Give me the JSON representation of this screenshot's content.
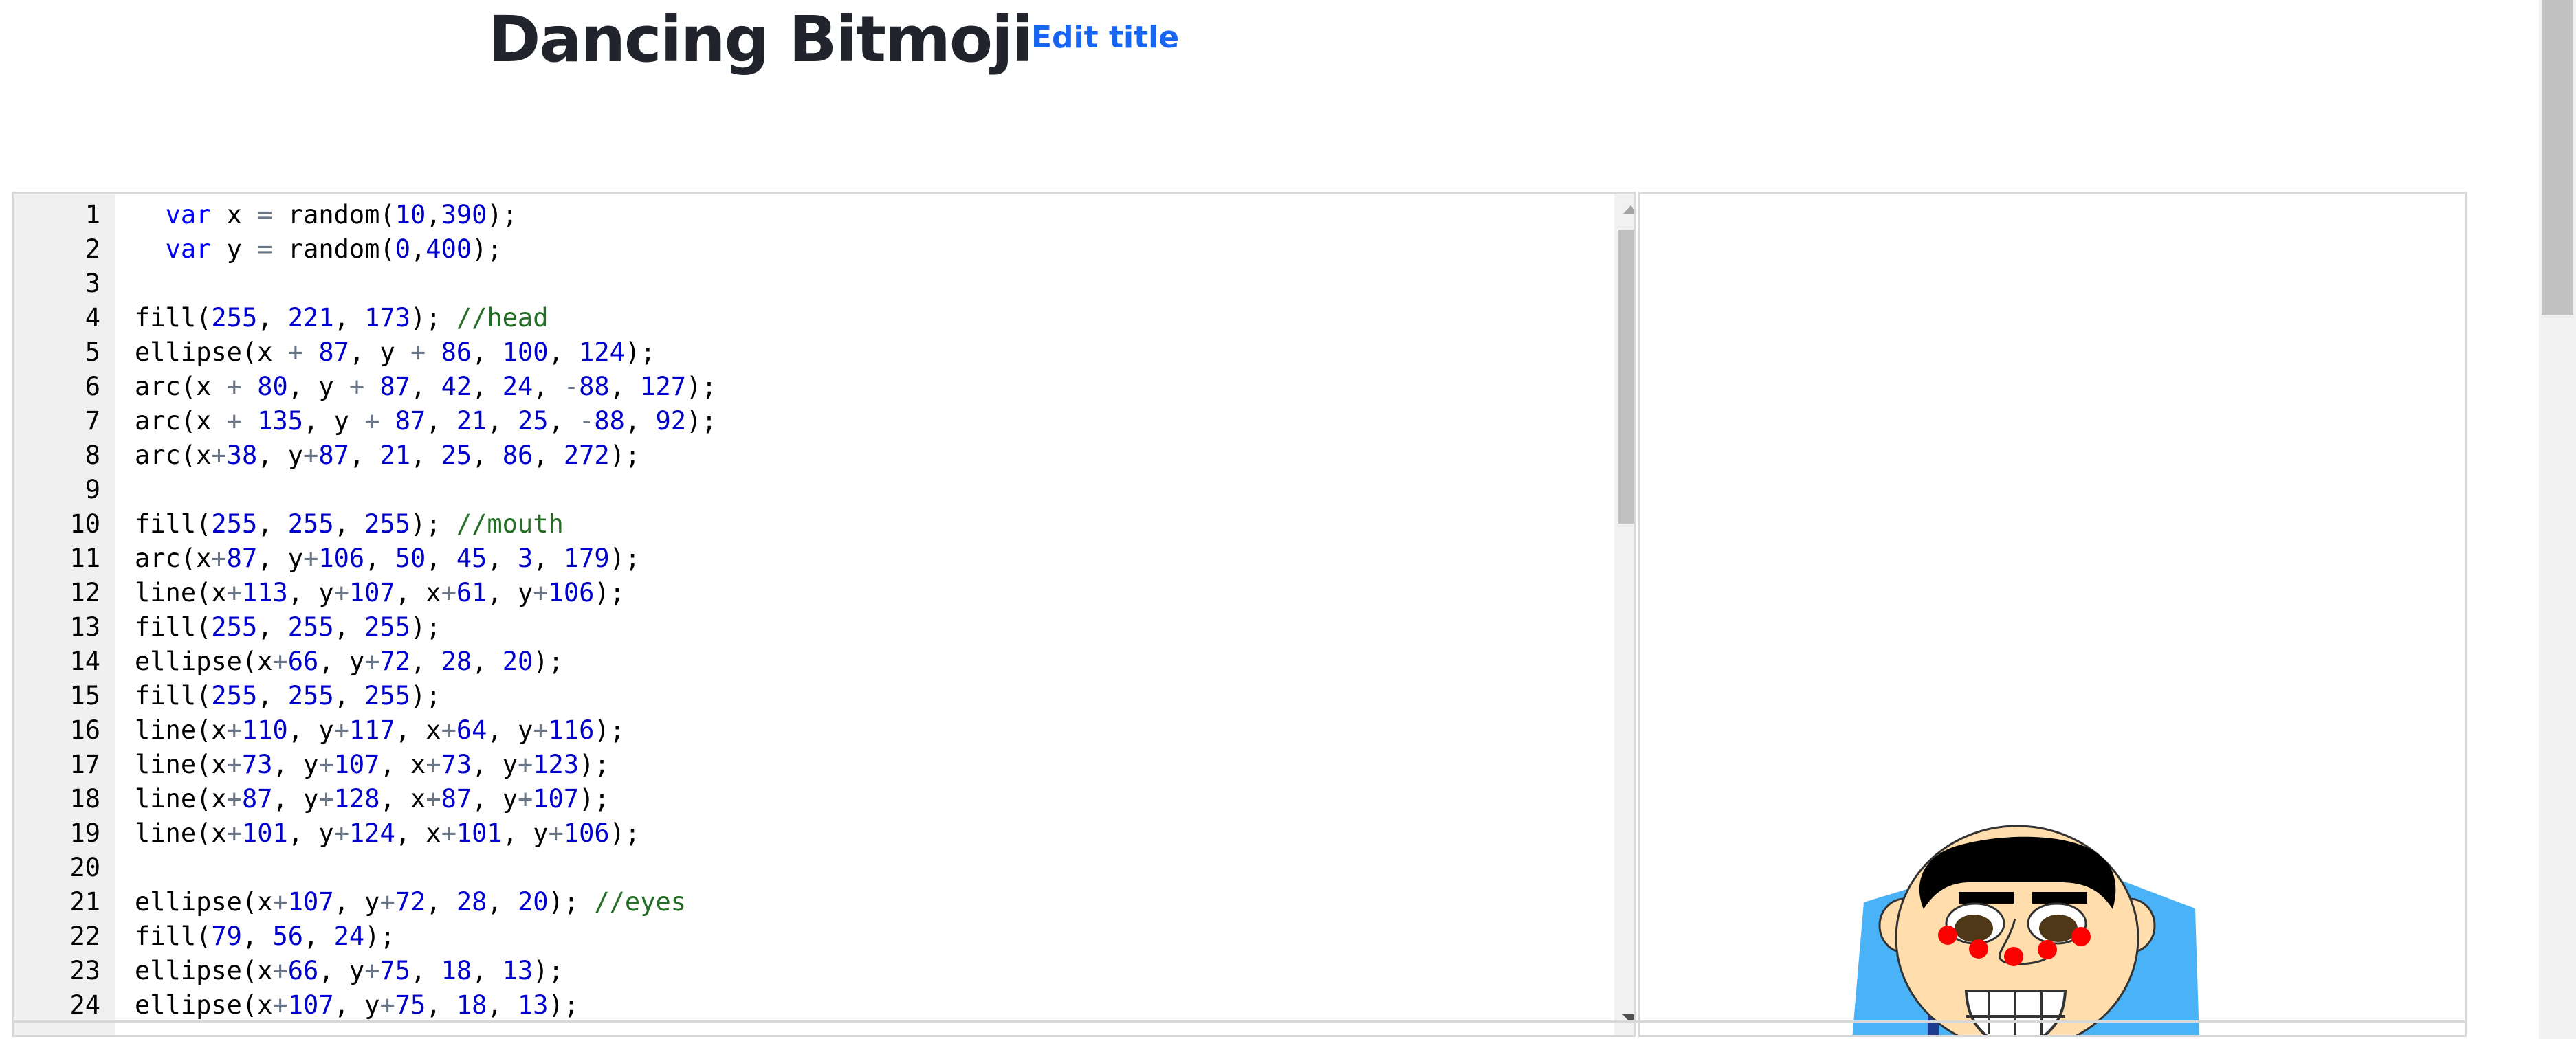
{
  "header": {
    "title": "Dancing Bitmoji",
    "edit_title_label": "Edit title"
  },
  "editor": {
    "line_numbers": [
      "1",
      "2",
      "3",
      "4",
      "5",
      "6",
      "7",
      "8",
      "9",
      "10",
      "11",
      "12",
      "13",
      "14",
      "15",
      "16",
      "17",
      "18",
      "19",
      "20",
      "21",
      "22",
      "23",
      "24"
    ],
    "lines": [
      "  var x = random(10,390);",
      "  var y = random(0,400);",
      "",
      "fill(255, 221, 173); //head",
      "ellipse(x + 87, y + 86, 100, 124);",
      "arc(x + 80, y + 87, 42, 24, -88, 127);",
      "arc(x + 135, y + 87, 21, 25, -88, 92);",
      "arc(x+38, y+87, 21, 25, 86, 272);",
      "",
      "fill(255, 255, 255); //mouth",
      "arc(x+87, y+106, 50, 45, 3, 179);",
      "line(x+113, y+107, x+61, y+106);",
      "fill(255, 255, 255);",
      "ellipse(x+66, y+72, 28, 20);",
      "fill(255, 255, 255);",
      "line(x+110, y+117, x+64, y+116);",
      "line(x+73, y+107, x+73, y+123);",
      "line(x+87, y+128, x+87, y+107);",
      "line(x+101, y+124, x+101, y+106);",
      "",
      "ellipse(x+107, y+72, 28, 20); //eyes",
      "fill(79, 56, 24);",
      "ellipse(x+66, y+75, 18, 13);",
      "ellipse(x+107, y+75, 18, 13);"
    ]
  },
  "colors": {
    "title": "#21242c",
    "link": "#1865f2",
    "keyword": "#0000ff",
    "number": "#0000cd",
    "operator": "#687687",
    "comment": "#236e24",
    "skin": "#ffddad",
    "hair": "#000000",
    "iris": "#4f3818",
    "shirt": "#4ab2f7",
    "necklace": "#ff0000",
    "shirt_letters": "#1d3c8f"
  },
  "icons": [
    "scroll-up-arrow-icon",
    "scroll-down-arrow-icon"
  ]
}
